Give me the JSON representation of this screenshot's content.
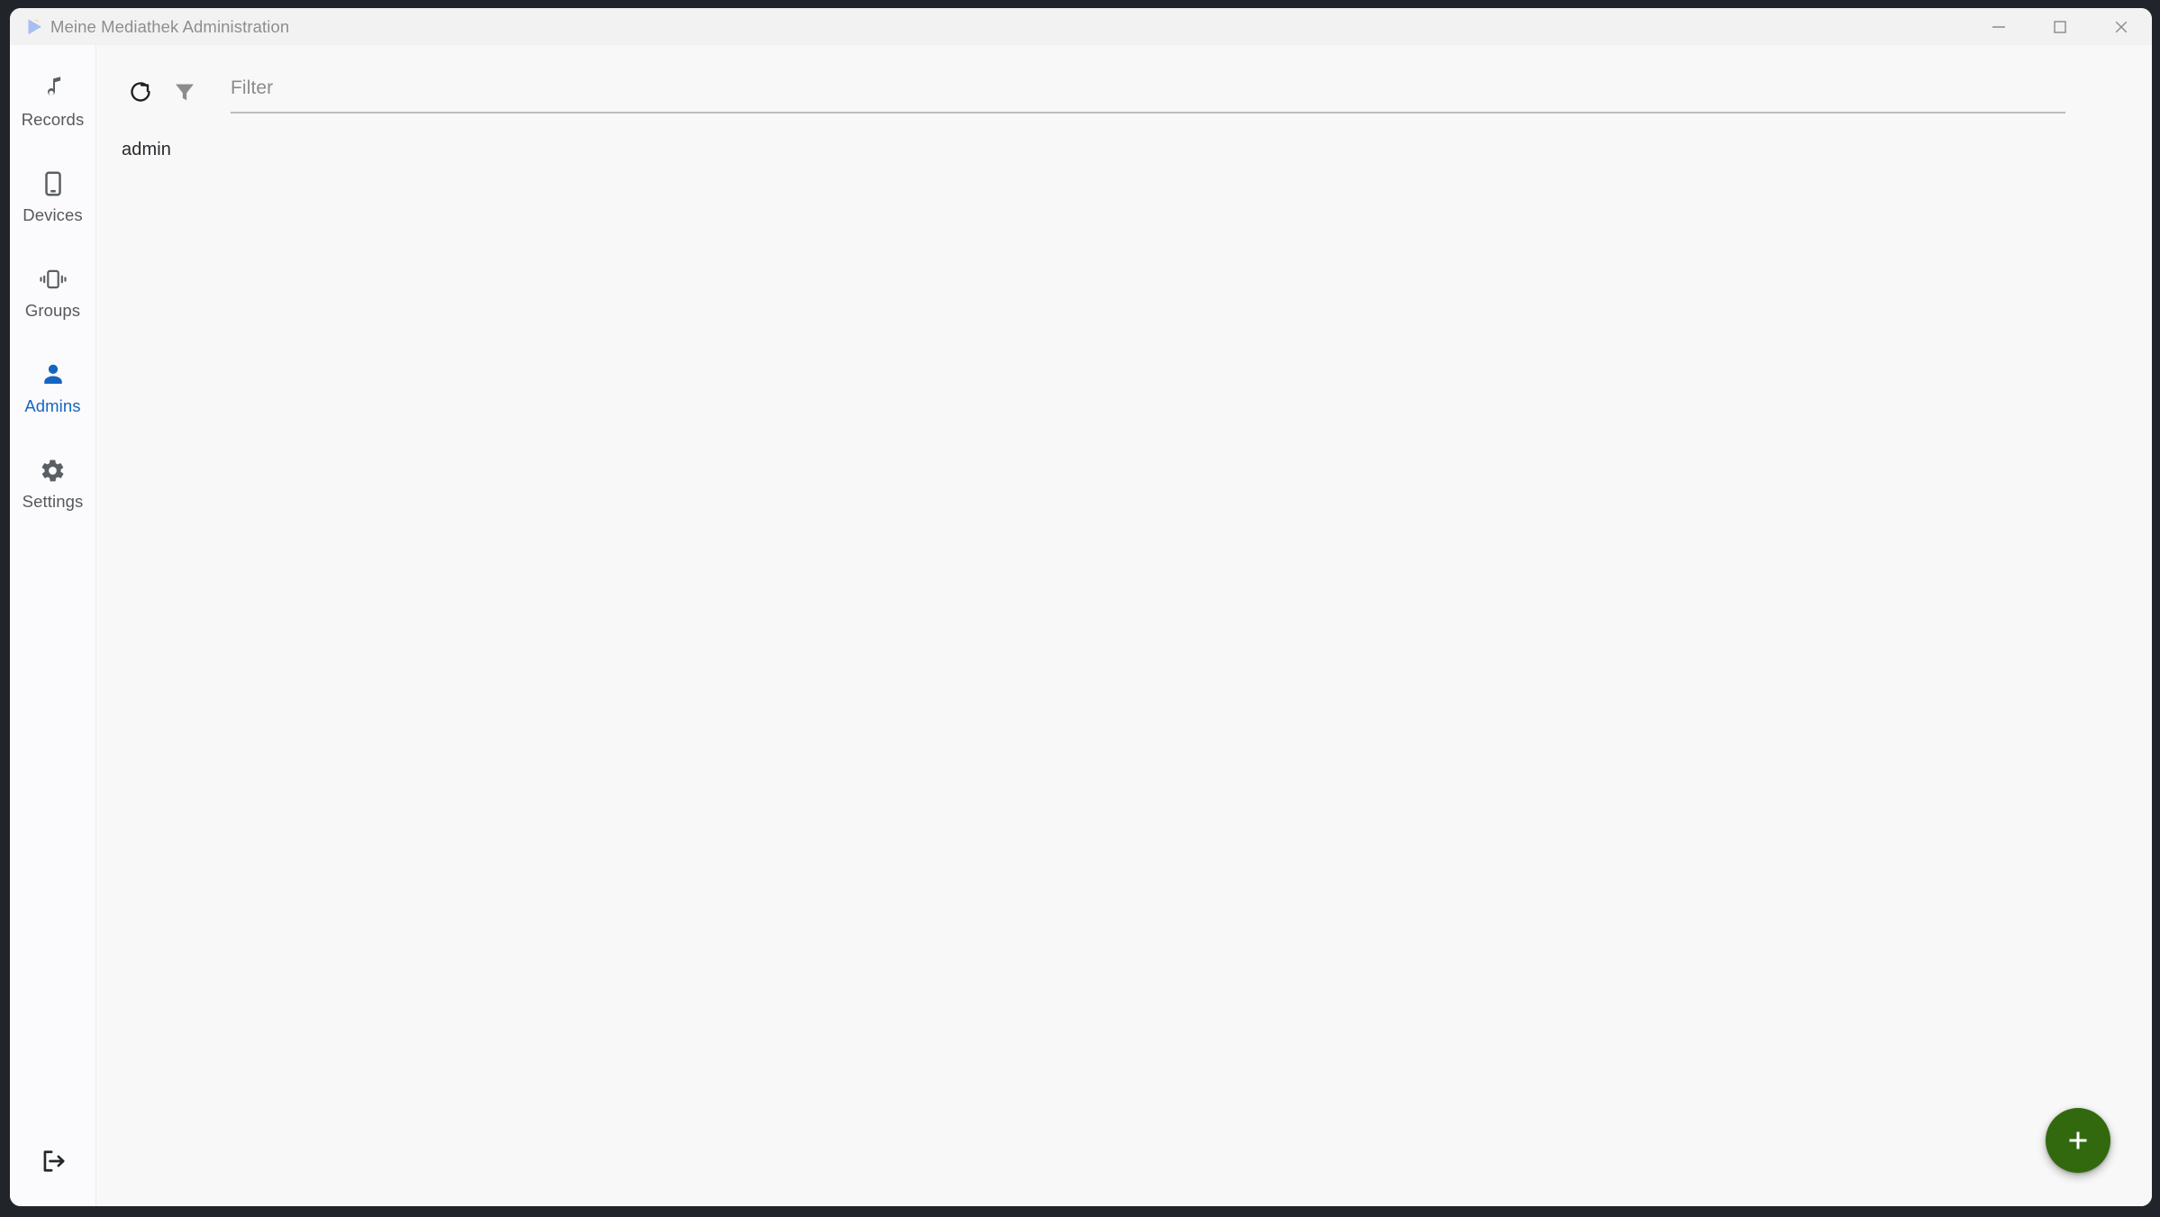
{
  "window": {
    "title": "Meine Mediathek Administration",
    "logo_icon": "play-triangle-logo",
    "controls": [
      {
        "name": "minimize",
        "icon": "minimize-icon"
      },
      {
        "name": "maximize",
        "icon": "maximize-icon"
      },
      {
        "name": "close",
        "icon": "close-icon"
      }
    ]
  },
  "sidebar": {
    "items": [
      {
        "label": "Records",
        "icon": "music-note-icon",
        "active": false
      },
      {
        "label": "Devices",
        "icon": "smartphone-icon",
        "active": false
      },
      {
        "label": "Groups",
        "icon": "vibrating-phone-icon",
        "active": false
      },
      {
        "label": "Admins",
        "icon": "person-icon",
        "active": true
      },
      {
        "label": "Settings",
        "icon": "gear-icon",
        "active": false
      }
    ],
    "logout": {
      "icon": "logout-icon",
      "label": "Logout"
    },
    "active_color": "#1565c0",
    "inactive_color": "#56595c"
  },
  "toolbar": {
    "refresh": {
      "icon": "refresh-icon",
      "label": "Refresh"
    },
    "filter_toggle": {
      "icon": "funnel-icon",
      "label": "Filter"
    },
    "filter_input": {
      "placeholder": "Filter",
      "value": ""
    }
  },
  "main": {
    "list": [
      {
        "name": "admin"
      }
    ]
  },
  "fab": {
    "icon": "plus-icon",
    "label": "Add",
    "color": "#33690e"
  }
}
